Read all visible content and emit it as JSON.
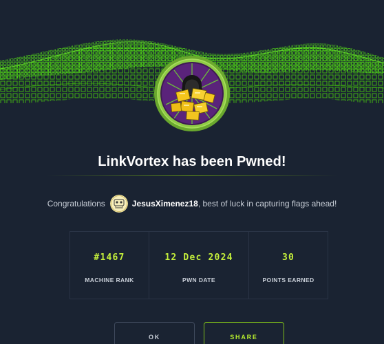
{
  "dialog": {
    "title": "LinkVortex has been Pwned!",
    "congrats_prefix": "Congratulations",
    "username": "JesusXimenez18",
    "congrats_suffix": ", best of luck in capturing flags ahead!"
  },
  "stats": [
    {
      "value": "#1467",
      "label": "MACHINE RANK"
    },
    {
      "value": "12 Dec 2024",
      "label": "PWN DATE"
    },
    {
      "value": "30",
      "label": "POINTS EARNED"
    }
  ],
  "buttons": {
    "ok": "OK",
    "share": "SHARE"
  },
  "colors": {
    "background": "#1a2332",
    "accent_green": "#9fef00",
    "stat_value": "#c4ef3b",
    "badge_ring": "#8ac43c",
    "badge_inner": "#6a2a8a"
  },
  "icons": {
    "badge": "machine-badge-icon",
    "avatar": "user-avatar-icon"
  }
}
